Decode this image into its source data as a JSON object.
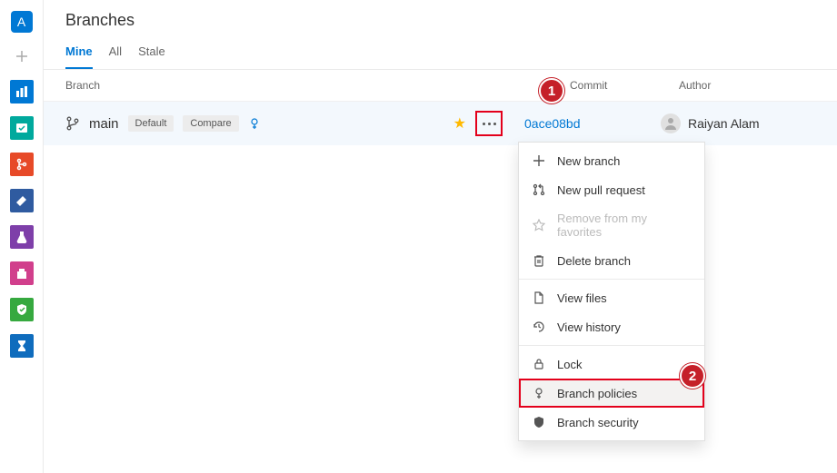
{
  "nav_badge": "A",
  "page_title": "Branches",
  "tabs": {
    "mine": "Mine",
    "all": "All",
    "stale": "Stale"
  },
  "columns": {
    "branch": "Branch",
    "commit": "Commit",
    "author": "Author"
  },
  "branch": {
    "name": "main",
    "default": "Default",
    "compare": "Compare",
    "commit": "0ace08bd",
    "author": "Raiyan Alam"
  },
  "menu": {
    "new_branch": "New branch",
    "new_pr": "New pull request",
    "remove_fav": "Remove from my favorites",
    "delete": "Delete branch",
    "view_files": "View files",
    "view_history": "View history",
    "lock": "Lock",
    "policies": "Branch policies",
    "security": "Branch security"
  },
  "callouts": {
    "one": "1",
    "two": "2"
  }
}
